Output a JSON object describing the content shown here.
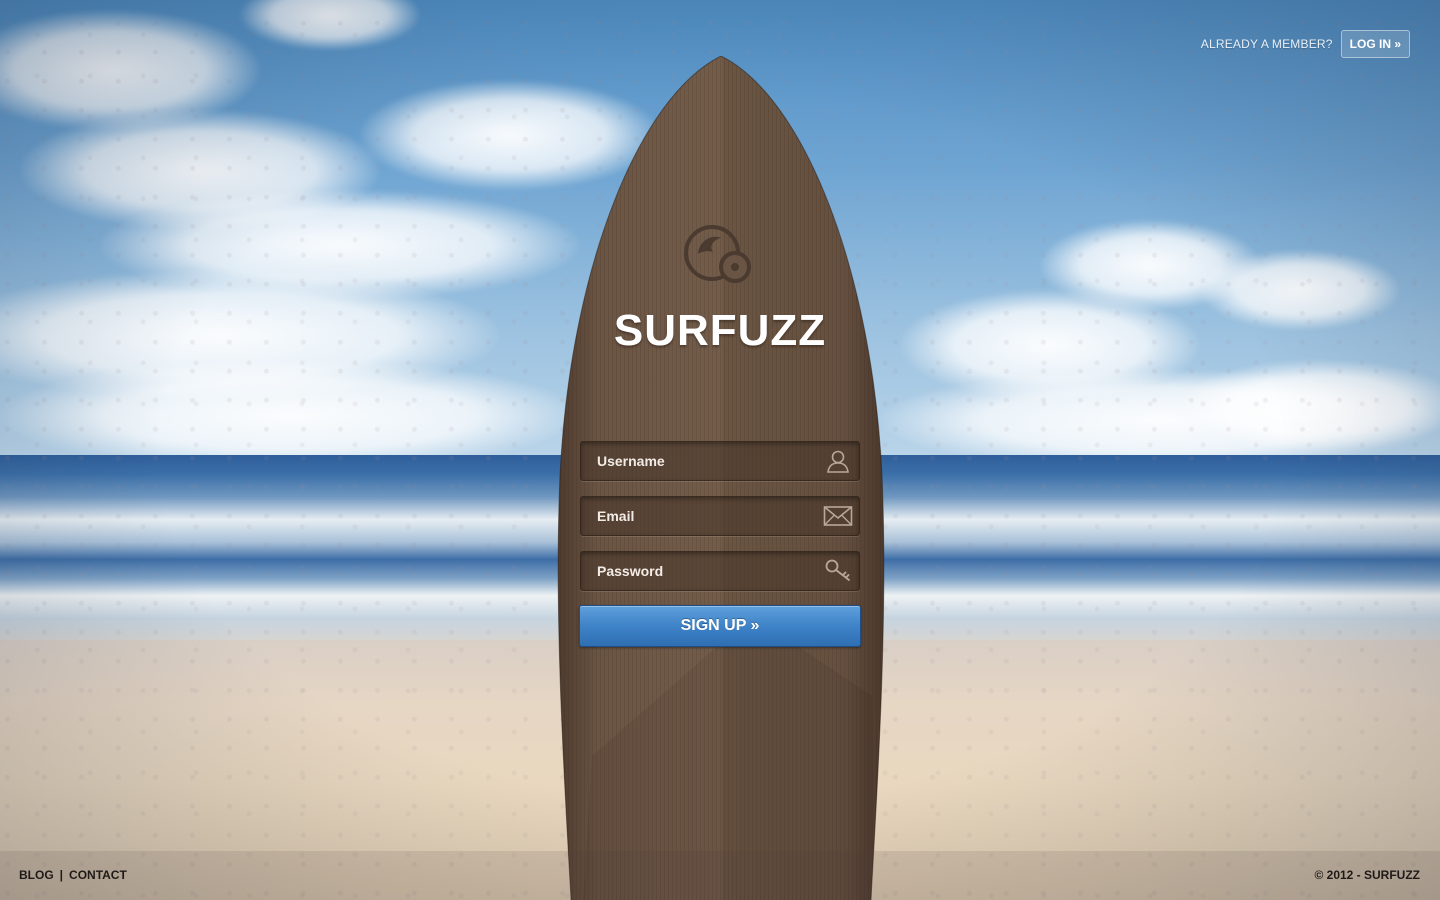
{
  "header": {
    "member_prompt": "ALREADY A MEMBER?",
    "login_label": "LOG IN »"
  },
  "brand": {
    "name": "SURFUZZ",
    "logo_icon": "surfuzz-logo-icon"
  },
  "form": {
    "username": {
      "placeholder": "Username",
      "value": "",
      "icon": "user-icon"
    },
    "email": {
      "placeholder": "Email",
      "value": "",
      "icon": "envelope-icon"
    },
    "password": {
      "placeholder": "Password",
      "value": "",
      "icon": "key-icon"
    },
    "submit_label": "SIGN UP »"
  },
  "footer": {
    "links": [
      {
        "label": "BLOG"
      },
      {
        "label": "CONTACT"
      }
    ],
    "separator": "|",
    "copyright": "© 2012 - SURFUZZ"
  },
  "colors": {
    "board_wood": "#6b5443",
    "button_blue": "#3f83c8",
    "text_dark": "#1f1a18"
  }
}
